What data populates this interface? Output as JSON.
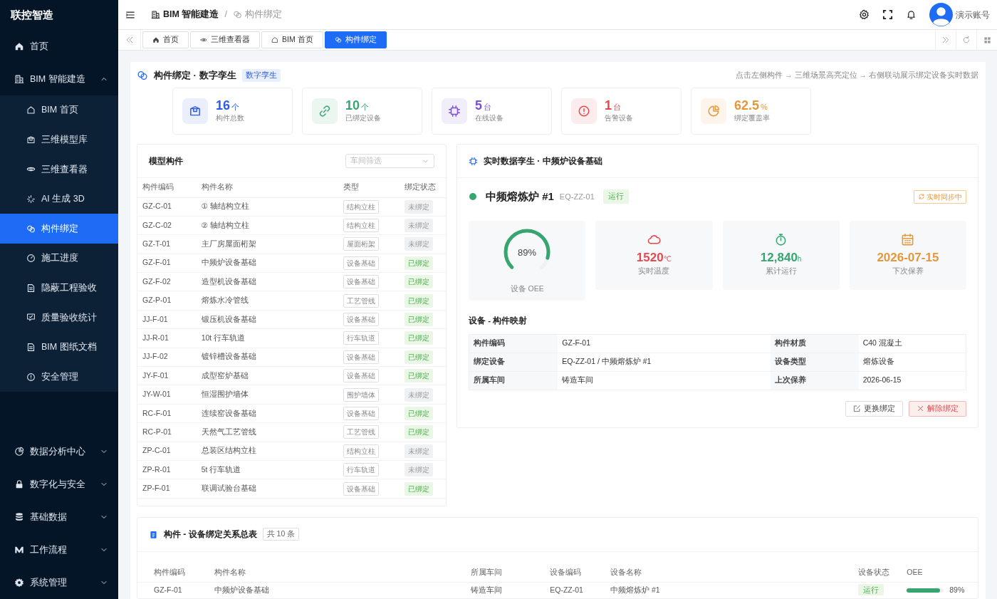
{
  "sidebar": {
    "brand": "联控智造",
    "items": [
      {
        "label": "首页",
        "selected": false
      },
      {
        "label": "BIM 智能建造",
        "selected": false,
        "expanded": true,
        "children": [
          {
            "label": "BIM 首页",
            "selected": false
          },
          {
            "label": "三维模型库",
            "selected": false
          },
          {
            "label": "三维查看器",
            "selected": false
          },
          {
            "label": "AI 生成 3D",
            "selected": false
          },
          {
            "label": "构件绑定",
            "selected": true
          },
          {
            "label": "施工进度",
            "selected": false
          },
          {
            "label": "隐蔽工程验收",
            "selected": false
          },
          {
            "label": "质量验收统计",
            "selected": false
          },
          {
            "label": "BIM 图纸文档",
            "selected": false
          },
          {
            "label": "安全管理",
            "selected": false
          }
        ]
      }
    ],
    "bottom_items": [
      {
        "label": "数据分析中心",
        "expanded": false
      },
      {
        "label": "数字化与安全",
        "expanded": false
      },
      {
        "label": "基础数据",
        "expanded": false
      },
      {
        "label": "工作流程",
        "expanded": false
      },
      {
        "label": "系统管理",
        "expanded": false
      }
    ]
  },
  "header": {
    "breadcrumb": [
      "BIM 智能建造",
      "构件绑定"
    ],
    "separator": "/",
    "user": "演示账号"
  },
  "tabs": [
    {
      "label": "首页",
      "selected": false
    },
    {
      "label": "三维查看器",
      "selected": false
    },
    {
      "label": "BIM 首页",
      "selected": false
    },
    {
      "label": "构件绑定",
      "selected": true
    }
  ],
  "page": {
    "title": "构件绑定 · 数字孪生",
    "tag": "数字孪生",
    "hint": "点击左侧构件 → 三维场景高亮定位 → 右侧联动展示绑定设备实时数据"
  },
  "stats": [
    {
      "value": "16",
      "unit": "个",
      "label": "构件总数",
      "color": "#2d5bea"
    },
    {
      "value": "10",
      "unit": "个",
      "label": "已绑定设备",
      "color": "#36a56f"
    },
    {
      "value": "5",
      "unit": "台",
      "label": "在线设备",
      "color": "#7b4fdc"
    },
    {
      "value": "1",
      "unit": "台",
      "label": "告警设备",
      "color": "#e5484d"
    },
    {
      "value": "62.5",
      "unit": "%",
      "label": "绑定覆盖率",
      "color": "#e8963a"
    }
  ],
  "parts": {
    "title": "模型构件",
    "filter": {
      "placeholder": "车间筛选"
    },
    "columns": [
      "构件编码",
      "构件名称",
      "类型",
      "绑定状态"
    ],
    "rows": [
      {
        "code": "GZ-C-01",
        "name": "① 轴结构立柱",
        "type": "结构立柱",
        "status": "未绑定",
        "bound": false
      },
      {
        "code": "GZ-C-02",
        "name": "② 轴结构立柱",
        "type": "结构立柱",
        "status": "未绑定",
        "bound": false
      },
      {
        "code": "GZ-T-01",
        "name": "主厂房屋面桁架",
        "type": "屋面桁架",
        "status": "未绑定",
        "bound": false
      },
      {
        "code": "GZ-F-01",
        "name": "中频炉设备基础",
        "type": "设备基础",
        "status": "已绑定",
        "bound": true
      },
      {
        "code": "GZ-F-02",
        "name": "造型机设备基础",
        "type": "设备基础",
        "status": "已绑定",
        "bound": true
      },
      {
        "code": "GZ-P-01",
        "name": "熔炼水冷管线",
        "type": "工艺管线",
        "status": "已绑定",
        "bound": true
      },
      {
        "code": "JJ-F-01",
        "name": "锻压机设备基础",
        "type": "设备基础",
        "status": "已绑定",
        "bound": true
      },
      {
        "code": "JJ-R-01",
        "name": "10t 行车轨道",
        "type": "行车轨道",
        "status": "已绑定",
        "bound": true
      },
      {
        "code": "JJ-F-02",
        "name": "镀锌槽设备基础",
        "type": "设备基础",
        "status": "已绑定",
        "bound": true
      },
      {
        "code": "JY-F-01",
        "name": "成型窑炉基础",
        "type": "设备基础",
        "status": "已绑定",
        "bound": true
      },
      {
        "code": "JY-W-01",
        "name": "恒湿围护墙体",
        "type": "围护墙体",
        "status": "未绑定",
        "bound": false
      },
      {
        "code": "RC-F-01",
        "name": "连续窑设备基础",
        "type": "设备基础",
        "status": "已绑定",
        "bound": true
      },
      {
        "code": "RC-P-01",
        "name": "天然气工艺管线",
        "type": "工艺管线",
        "status": "已绑定",
        "bound": true
      },
      {
        "code": "ZP-C-01",
        "name": "总装区结构立柱",
        "type": "结构立柱",
        "status": "未绑定",
        "bound": false
      },
      {
        "code": "ZP-R-01",
        "name": "5t 行车轨道",
        "type": "行车轨道",
        "status": "未绑定",
        "bound": false
      },
      {
        "code": "ZP-F-01",
        "name": "联调试验台基础",
        "type": "设备基础",
        "status": "已绑定",
        "bound": true
      }
    ]
  },
  "twin": {
    "title": "实时数据孪生 · 中频炉设备基础",
    "device": "中频熔炼炉 #1",
    "code": "EQ-ZZ-01",
    "state": "运行",
    "running": true,
    "sync": "实时同步中",
    "oee": {
      "value": "89%",
      "level": 0.89,
      "label": "设备 OEE"
    },
    "metrics": [
      {
        "value": "1520",
        "unit": "℃",
        "label": "实时温度",
        "color": "#e5484d"
      },
      {
        "value": "12,840",
        "unit": "h",
        "label": "累计运行",
        "color": "#36a56f"
      },
      {
        "value": "2026-07-15",
        "label": "下次保养",
        "color": "#e8963a"
      }
    ],
    "mapping_title": "设备 - 构件映射",
    "mapping": [
      [
        "构件编码",
        "GZ-F-01",
        "构件材质",
        "C40 混凝土"
      ],
      [
        "绑定设备",
        "EQ-ZZ-01 / 中频熔炼炉 #1",
        "设备类型",
        "熔炼设备"
      ],
      [
        "所属车间",
        "铸造车间",
        "上次保养",
        "2026-06-15"
      ]
    ],
    "buttons": [
      {
        "label": "更换绑定",
        "kind": "default"
      },
      {
        "label": "解除绑定",
        "kind": "danger"
      }
    ]
  },
  "relations": {
    "title": "构件 - 设备绑定关系总表",
    "count": "共 10 条",
    "columns": [
      "构件编码",
      "构件名称",
      "所属车间",
      "设备编码",
      "设备名称",
      "设备状态",
      "OEE"
    ],
    "rows": [
      {
        "code": "GZ-F-01",
        "name": "中频炉设备基础",
        "shop": "铸造车间",
        "device_code": "EQ-ZZ-01",
        "device": "中频熔炼炉 #1",
        "state": "运行",
        "running": true,
        "oee": "89%",
        "level": 0.89
      }
    ]
  }
}
